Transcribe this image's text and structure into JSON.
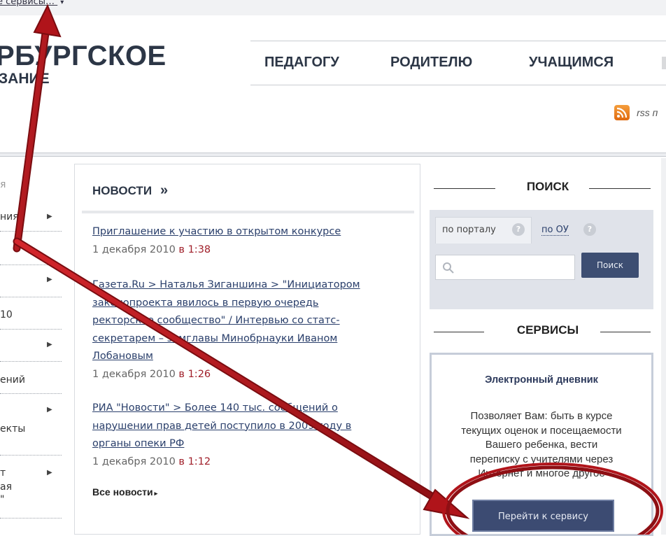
{
  "topbar": {
    "all_services": "е сервисы…",
    "caret": "▾"
  },
  "logo": {
    "line1": "РБУРГСКОЕ",
    "line2": "ЗАНИЕ"
  },
  "nav": {
    "items": [
      "ПЕДАГОГУ",
      "РОДИТЕЛЮ",
      "УЧАЩИМСЯ"
    ]
  },
  "rss": {
    "label": "rss п"
  },
  "sidebar": {
    "items": [
      "я",
      "ния",
      "10",
      "ений",
      "екты",
      "т",
      "ая",
      "\""
    ]
  },
  "news": {
    "title": "НОВОСТИ",
    "more_glyph": "»",
    "items": [
      {
        "lines": [
          "Приглашение к участию в открытом конкурсе"
        ],
        "date": "1 декабря 2010",
        "at": "в",
        "time": "1:38"
      },
      {
        "lines": [
          "Газета.Ru > Наталья Зиганшина > \"Инициатором",
          "законопроекта явилось в первую очередь",
          "ректорское сообщество\" / Интервью со статс-",
          "секретарем – замглавы Минобрнауки Иваном",
          "Лобановым"
        ],
        "date": "1 декабря 2010",
        "at": "в",
        "time": "1:26"
      },
      {
        "lines": [
          "РИА \"Новости\" > Более 140 тыс. сообщений о",
          "нарушении прав детей поступило в 2009 году в",
          "органы опеки РФ"
        ],
        "date": "1 декабря 2010",
        "at": "в",
        "time": "1:12"
      }
    ],
    "all_news": "Все новости",
    "all_news_glyph": "▸"
  },
  "search": {
    "heading": "ПОИСК",
    "tabs": [
      "по порталу",
      "по ОУ"
    ],
    "help": "?",
    "input_value": "",
    "button": "Поиск"
  },
  "services": {
    "heading": "СЕРВИСЫ",
    "card_title": "Электронный дневник",
    "description": [
      "Позволяет Вам: быть в курсе",
      "текущих оценок и посещаемости",
      "Вашего ребенка, вести",
      "переписку с учителями через",
      "Интернет и многое другое"
    ],
    "button": "Перейти к сервису"
  },
  "colors": {
    "header_text": "#2c3646",
    "link": "#2a3f6b",
    "time_accent": "#a01f2a",
    "button": "#3c4b72",
    "annotation_arrow": "#b0141a"
  }
}
